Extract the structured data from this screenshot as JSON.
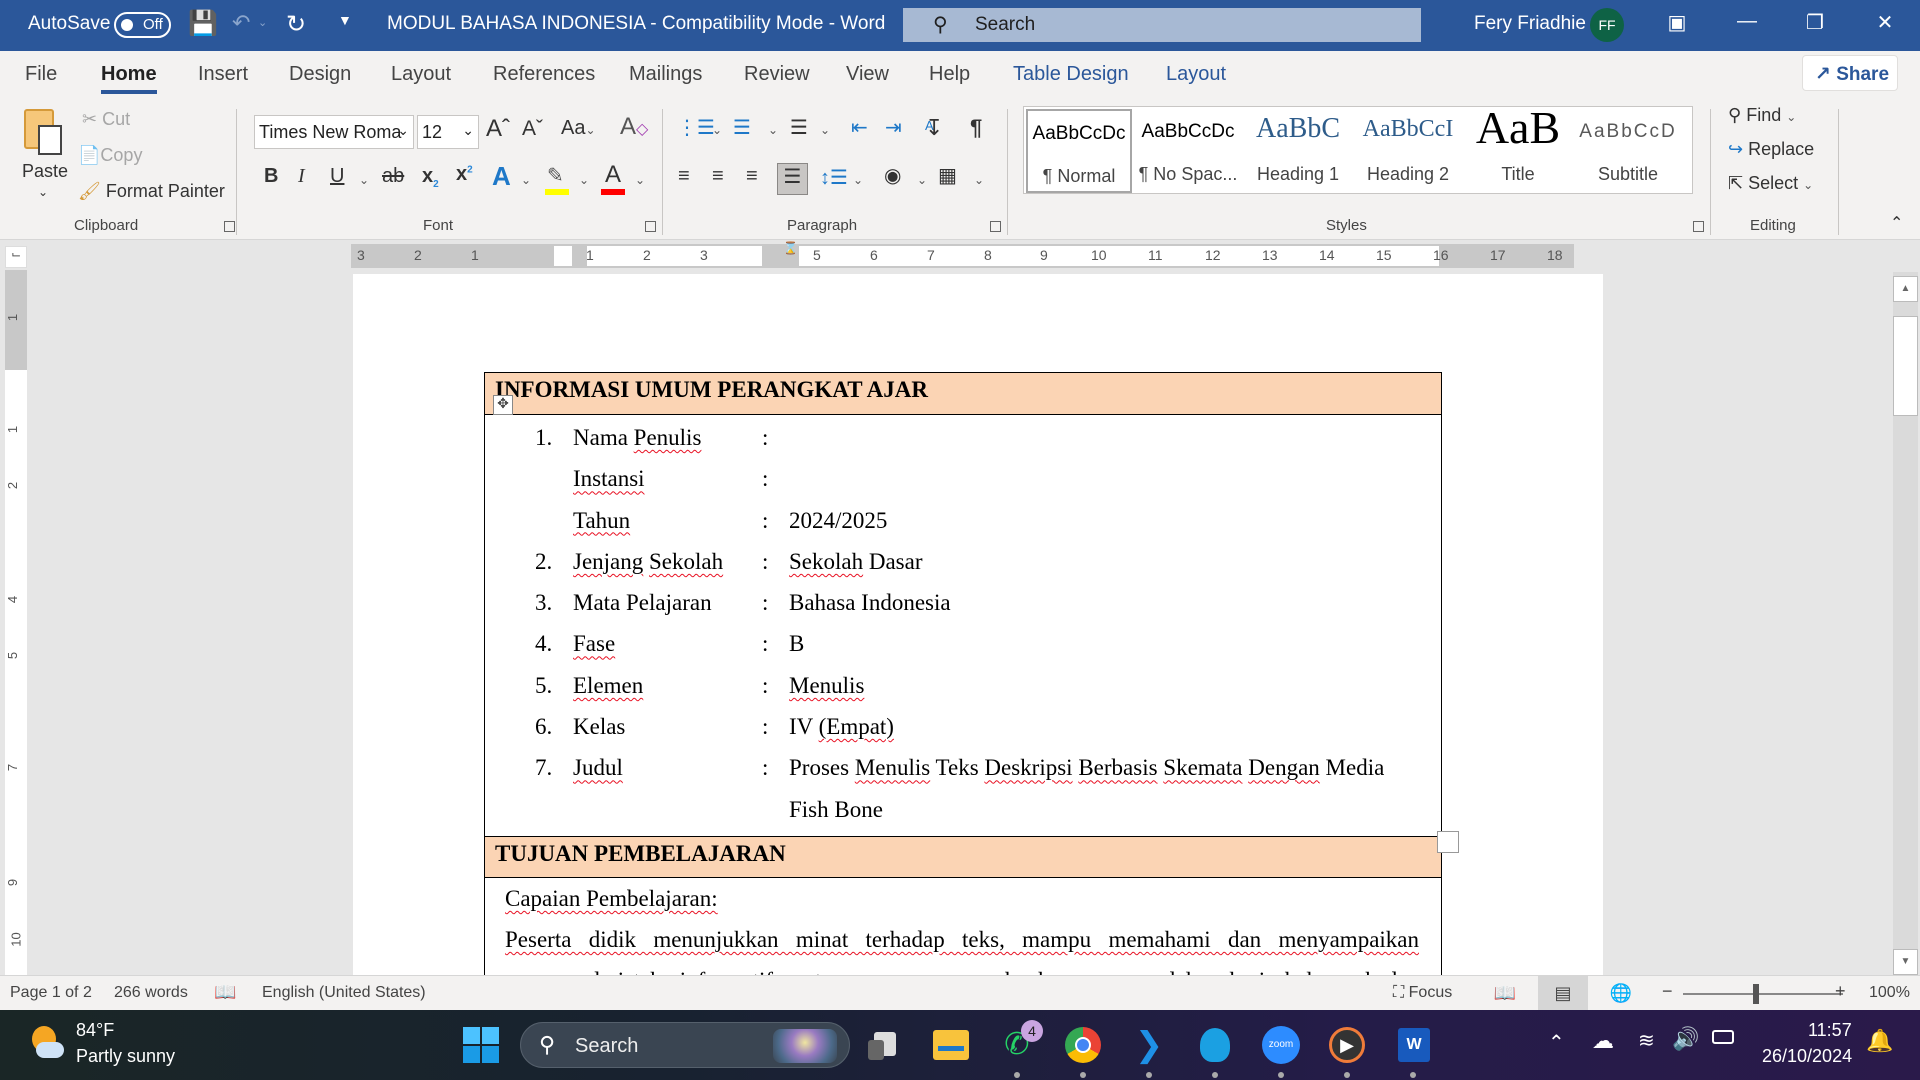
{
  "titlebar": {
    "autosave_label": "AutoSave",
    "autosave_state": "Off",
    "document_title": "MODUL BAHASA INDONESIA  -  Compatibility Mode  -  Word",
    "search_placeholder": "Search",
    "user_name": "Fery Friadhie",
    "user_initials": "FF",
    "avatar_color": "#0e6245",
    "accent_color": "#2b579a"
  },
  "tabs": [
    {
      "label": "File"
    },
    {
      "label": "Home",
      "active": true
    },
    {
      "label": "Insert"
    },
    {
      "label": "Design"
    },
    {
      "label": "Layout"
    },
    {
      "label": "References"
    },
    {
      "label": "Mailings"
    },
    {
      "label": "Review"
    },
    {
      "label": "View"
    },
    {
      "label": "Help"
    },
    {
      "label": "Table Design",
      "contextual": true
    },
    {
      "label": "Layout",
      "contextual": true
    }
  ],
  "share_label": "Share",
  "ribbon": {
    "clipboard": {
      "group_label": "Clipboard",
      "paste": "Paste",
      "cut": "Cut",
      "copy": "Copy",
      "format_painter": "Format Painter"
    },
    "font": {
      "group_label": "Font",
      "font_name": "Times New Roma",
      "font_size": "12",
      "highlight_color": "#ffff00",
      "font_color": "#ff0000"
    },
    "paragraph": {
      "group_label": "Paragraph",
      "active_alignment": "justify"
    },
    "styles": {
      "group_label": "Styles",
      "items": [
        {
          "preview": "AaBbCcDc",
          "name": "¶ Normal",
          "selected": true
        },
        {
          "preview": "AaBbCcDc",
          "name": "¶ No Spac..."
        },
        {
          "preview": "AaBbC",
          "name": "Heading 1"
        },
        {
          "preview": "AaBbCcI",
          "name": "Heading 2"
        },
        {
          "preview": "AaB",
          "name": "Title"
        },
        {
          "preview": "AaBbCcD",
          "name": "Subtitle"
        }
      ]
    },
    "editing": {
      "group_label": "Editing",
      "find": "Find",
      "replace": "Replace",
      "select": "Select"
    }
  },
  "ruler": {
    "horizontal_left": [
      "3",
      "2",
      "1"
    ],
    "horizontal": [
      "1",
      "2",
      "3",
      "5",
      "6",
      "7",
      "8",
      "9",
      "10",
      "11",
      "12",
      "13",
      "14",
      "15",
      "16",
      "17",
      "18"
    ],
    "vertical": [
      "1",
      "1",
      "2",
      "4",
      "5",
      "7",
      "9",
      "10"
    ]
  },
  "document": {
    "section1_header": "INFORMASI UMUM PERANGKAT AJAR",
    "info_rows": [
      {
        "num": "1.",
        "key": "Nama Penulis",
        "colon": ":",
        "value": ""
      },
      {
        "num": "",
        "key": "Instansi",
        "colon": ":",
        "value": ""
      },
      {
        "num": "",
        "key": "Tahun",
        "colon": ":",
        "value": "2024/2025"
      },
      {
        "num": "2.",
        "key": "Jenjang Sekolah",
        "colon": ":",
        "value": "Sekolah Dasar"
      },
      {
        "num": "3.",
        "key": "Mata Pelajaran",
        "colon": ":",
        "value": "Bahasa Indonesia"
      },
      {
        "num": "4.",
        "key": "Fase",
        "colon": ":",
        "value": "B"
      },
      {
        "num": "5.",
        "key": "Elemen",
        "colon": ":",
        "value": "Menulis"
      },
      {
        "num": "6.",
        "key": "Kelas",
        "colon": ":",
        "value": "IV (Empat)"
      },
      {
        "num": "7.",
        "key": "Judul",
        "colon": ":",
        "value": "Proses Menulis Teks Deskripsi Berbasis Skemata Dengan Media"
      },
      {
        "num": "",
        "key": "",
        "colon": "",
        "value": "Fish Bone"
      }
    ],
    "section2_header": "TUJUAN PEMBELAJARAN",
    "capaian_label": "Capaian Pembelajaran:",
    "capaian_line1": "Peserta didik menunjukkan minat terhadap teks, mampu memahami dan menyampaikan",
    "capaian_line2": "gagasan dari teks informatif, serta mampu mengungkapkan gagasan dalam kerja kelompok dan",
    "header_fill_color": "#fbd4b4"
  },
  "statusbar": {
    "page": "Page 1 of 2",
    "words": "266 words",
    "language": "English (United States)",
    "focus": "Focus",
    "zoom": "100%",
    "zoom_minus": "−",
    "zoom_plus": "+"
  },
  "taskbar": {
    "weather_temp": "84°F",
    "weather_desc": "Partly sunny",
    "search_placeholder": "Search",
    "whatsapp_badge": "4",
    "zoom_label": "zoom",
    "time": "11:57",
    "date": "26/10/2024"
  }
}
